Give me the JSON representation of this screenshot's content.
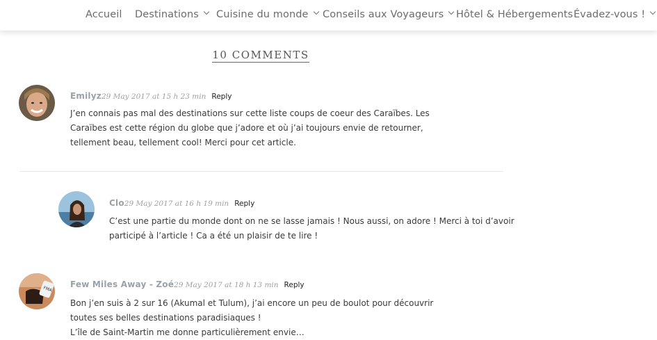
{
  "nav": {
    "items": [
      {
        "label": "Accueil",
        "dropdown": false
      },
      {
        "label": "Destinations",
        "dropdown": true
      },
      {
        "label": "Cuisine du monde",
        "dropdown": true
      },
      {
        "label": "Conseils aux Voyageurs",
        "dropdown": true
      },
      {
        "label": "Hôtel & Hébergements",
        "dropdown": false
      },
      {
        "label": "Évadez-vous !",
        "dropdown": true
      }
    ]
  },
  "comments_heading": "10 COMMENTS",
  "comments": [
    {
      "author": "Emilyz",
      "date": "29 May 2017 at 15 h 23 min",
      "reply": "Reply",
      "lines": [
        "J’en connais pas mal des destinations sur cette liste coups de coeur des Caraïbes. Les",
        "Caraïbes est cette région du globe que j’adore et où j’ai toujours envie de retourner,",
        "tellement beau, tellement cool! Merci pour cet article."
      ]
    },
    {
      "author": "Clo",
      "date": "29 May 2017 at 16 h 19 min",
      "reply": "Reply",
      "lines": [
        "C’est une partie du monde dont on ne se lasse jamais ! Nous aussi, on adore ! Merci à toi d’avoir",
        "participé à l’article ! Ca a été un plaisir de te lire !"
      ]
    },
    {
      "author": "Few Miles Away - Zoé",
      "date": "29 May 2017 at 18 h 13 min",
      "reply": "Reply",
      "lines": [
        "Bon j’en suis à 2 sur 16 (Akumal et Tulum), j’ai encore un peu de boulot pour découvrir",
        "toutes ses belles destinations paradisiaques !",
        "L’île de Saint-Martin me donne particulièrement envie…"
      ]
    }
  ],
  "colors": {
    "author": "#9aa2a8",
    "nav_text": "#6c6c6c"
  }
}
